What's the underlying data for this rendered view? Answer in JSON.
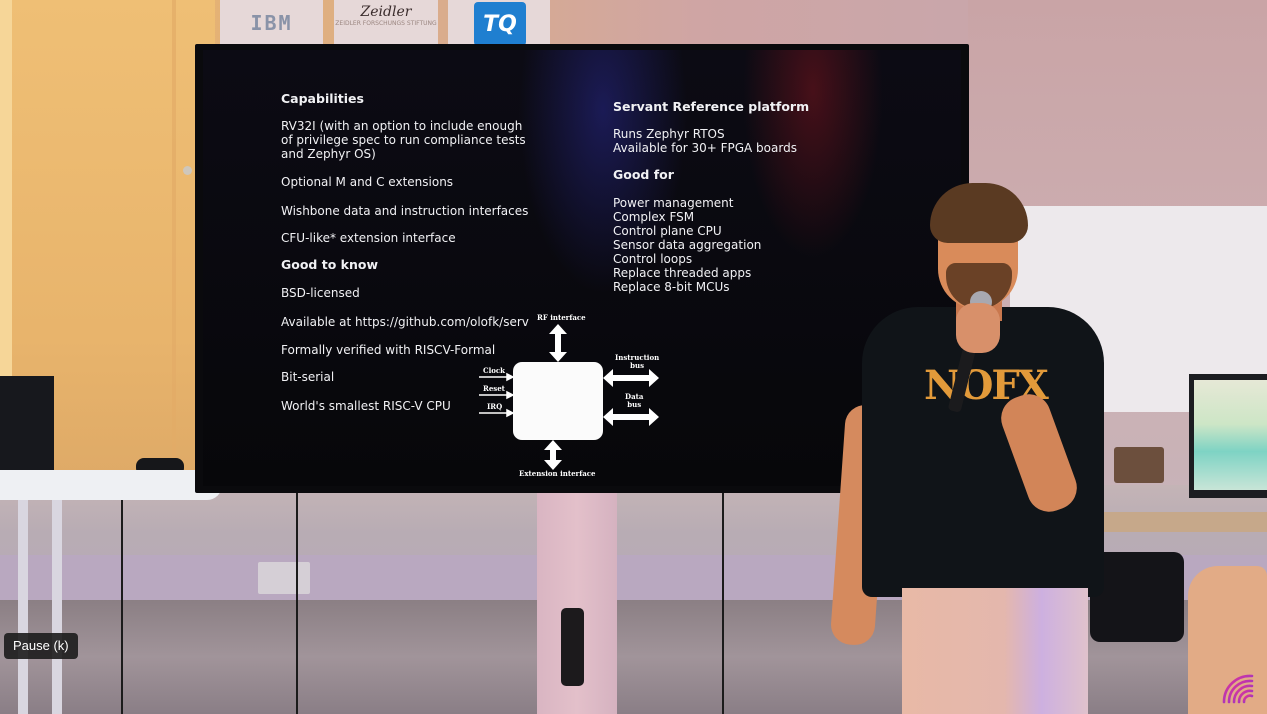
{
  "player": {
    "tooltip": "Pause (k)",
    "shortcut_key": "k",
    "watermark_icon": "channel-logo-icon"
  },
  "sponsors": {
    "ibm": "IBM",
    "zeidler_signature": "Zeidler",
    "zeidler_text": "ZEIDLER FORSCHUNGS STIFTUNG",
    "tq": "TQ"
  },
  "slide": {
    "left_column": {
      "capabilities_heading": "Capabilities",
      "capabilities": [
        [
          "RV32I (with an option to include enough",
          "of privilege spec to run compliance tests",
          "and Zephyr OS)"
        ],
        [
          "Optional M and C extensions"
        ],
        [
          "Wishbone data and instruction interfaces"
        ],
        [
          "CFU-like* extension interface"
        ]
      ],
      "good_to_know_heading": "Good to know",
      "good_to_know": [
        "BSD-licensed",
        "Available at https://github.com/olofk/serv",
        "Formally verified with RISCV-Formal",
        "Bit-serial",
        "World's smallest RISC-V CPU"
      ]
    },
    "right_column": {
      "platform_heading": "Servant Reference platform",
      "platform_items": [
        "Runs Zephyr RTOS",
        "Available for 30+ FPGA boards"
      ],
      "good_for_heading": "Good for",
      "good_for": [
        "Power management",
        "Complex FSM",
        "Control plane CPU",
        "Sensor data aggregation",
        "Control loops",
        "Replace threaded apps",
        "Replace 8-bit MCUs"
      ]
    },
    "diagram": {
      "top": "RF interface",
      "bottom": "Extension interface",
      "inputs": [
        "Clock",
        "Reset",
        "IRQ"
      ],
      "instruction_bus": [
        "Instruction",
        "bus"
      ],
      "data_bus": [
        "Data",
        "bus"
      ]
    }
  },
  "scene": {
    "shirt_print": "NOFX"
  },
  "colors": {
    "slide_text": "#f1f1f4",
    "tooltip_bg": "#1c1c1c",
    "tq_blue": "#1f7fd0",
    "shirt_print": "#e29a3a",
    "watermark_gradient_start": "#e8358f",
    "watermark_gradient_end": "#7b35e0"
  }
}
